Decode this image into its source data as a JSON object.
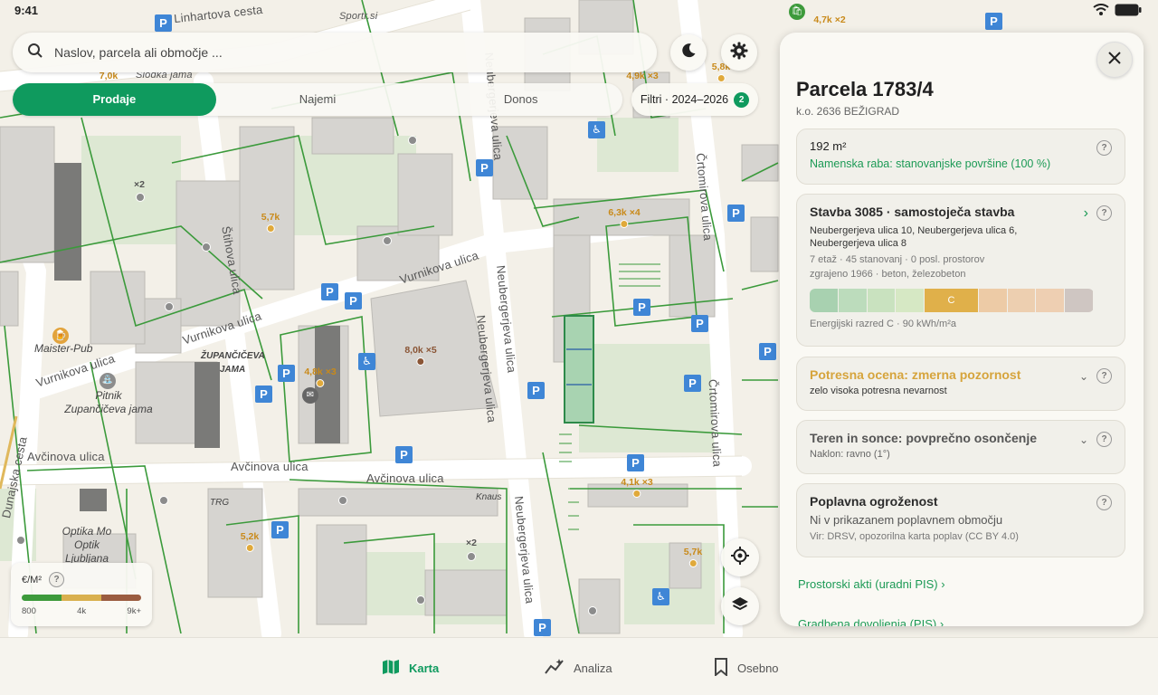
{
  "status": {
    "time": "9:41"
  },
  "search": {
    "placeholder": "Naslov, parcela ali območje ..."
  },
  "mode_tabs": [
    {
      "label": "Prodaje",
      "active": true
    },
    {
      "label": "Najemi",
      "active": false
    },
    {
      "label": "Donos",
      "active": false
    }
  ],
  "filter": {
    "label": "Filtri · 2024–2026",
    "count": "2"
  },
  "legend": {
    "title": "€/M²",
    "ticks": [
      "800",
      "4k",
      "9k+"
    ],
    "colors": [
      "#3d9a3b",
      "#d9b04e",
      "#9b5c40"
    ]
  },
  "map": {
    "streets": [
      "Linhartova cesta",
      "Slodka jama",
      "Štihova ulica",
      "Vurnikova ulica",
      "Vurnikova ulica",
      "Vurnikova ulica",
      "Neubergerjeva ulica",
      "Neubergerjeva ulica",
      "Neubergerjeva ulica",
      "Neubergerjeva ulica",
      "Črtomirova ulica",
      "Črtomirova ulica",
      "Avčinova ulica",
      "Avčinova ulica",
      "Avčinova ulica",
      "Neubergerjeva ulica",
      "Dunajska cesta",
      "Sportr.si"
    ],
    "pois": [
      "Maister-Pub",
      "ŽUPANČIČEVA JAMA",
      "Pitnik Zupančičeva jama",
      "Optika Mo Optik Ljubljana",
      "TRG",
      "Knaus"
    ],
    "prices": [
      "7,0k",
      "5,7k",
      "4,8k ×3",
      "8,0k ×5",
      "6,3k ×4",
      "4,9k ×3",
      "5,8k",
      "4,7k ×2",
      "4,1k ×3",
      "5,2k",
      "5,7k",
      "×2",
      "×2"
    ]
  },
  "panel": {
    "title": "Parcela 1783/4",
    "subtitle": "k.o. 2636 BEŽIGRAD",
    "area": {
      "value": "192 m²",
      "zoning": "Namenska raba: stanovanjske površine (100 %)"
    },
    "building": {
      "title": "Stavba 3085 · samostoječa stavba",
      "address": "Neubergerjeva ulica 10, Neubergerjeva ulica 6, Neubergerjeva ulica 8",
      "stats": "7 etaž · 45 stanovanj · 0 posl. prostorov",
      "built": "zgrajeno 1966 · beton, železobeton",
      "energy_class": "C",
      "energy_text": "Energijski razred C · 90 kWh/m²a",
      "energy_colors": [
        "#a8d1b0",
        "#bcdcbc",
        "#c9e2bf",
        "#d6e8c4",
        "#e0b04a",
        "#edcba6",
        "#edcfb0",
        "#eecfb2",
        "#cfc6c2"
      ]
    },
    "seismic": {
      "title": "Potresna ocena: zmerna pozornost",
      "sub": "zelo visoka potresna nevarnost"
    },
    "terrain": {
      "title": "Teren in sonce: povprečno osončenje",
      "sub": "Naklon: ravno (1°)"
    },
    "flood": {
      "title": "Poplavna ogroženost",
      "sub": "Ni v prikazanem poplavnem območju",
      "source": "Vir: DRSV, opozorilna karta poplav (CC BY 4.0)"
    },
    "link1": "Prostorski akti (uradni PIS) ›",
    "link2": "Gradbena dovoljenja (PIS) ›"
  },
  "nav": [
    {
      "label": "Karta",
      "active": true
    },
    {
      "label": "Analiza",
      "active": false
    },
    {
      "label": "Osebno",
      "active": false
    }
  ]
}
